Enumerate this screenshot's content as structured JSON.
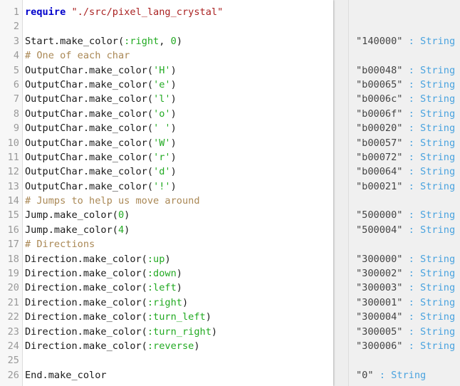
{
  "editor": {
    "lines": [
      {
        "n": "1",
        "tokens": [
          {
            "t": "kw",
            "v": "require"
          },
          {
            "t": "plain",
            "v": " "
          },
          {
            "t": "str",
            "v": "\"./src/pixel_lang_crystal\""
          }
        ]
      },
      {
        "n": "2",
        "tokens": []
      },
      {
        "n": "3",
        "tokens": [
          {
            "t": "plain",
            "v": "Start.make_color("
          },
          {
            "t": "sym",
            "v": ":right"
          },
          {
            "t": "plain",
            "v": ", "
          },
          {
            "t": "num",
            "v": "0"
          },
          {
            "t": "plain",
            "v": ")"
          }
        ]
      },
      {
        "n": "4",
        "tokens": [
          {
            "t": "cmt",
            "v": "# One of each char"
          }
        ]
      },
      {
        "n": "5",
        "tokens": [
          {
            "t": "plain",
            "v": "OutputChar.make_color("
          },
          {
            "t": "sym",
            "v": "'H'"
          },
          {
            "t": "plain",
            "v": ")"
          }
        ]
      },
      {
        "n": "6",
        "tokens": [
          {
            "t": "plain",
            "v": "OutputChar.make_color("
          },
          {
            "t": "sym",
            "v": "'e'"
          },
          {
            "t": "plain",
            "v": ")"
          }
        ]
      },
      {
        "n": "7",
        "tokens": [
          {
            "t": "plain",
            "v": "OutputChar.make_color("
          },
          {
            "t": "sym",
            "v": "'l'"
          },
          {
            "t": "plain",
            "v": ")"
          }
        ]
      },
      {
        "n": "8",
        "tokens": [
          {
            "t": "plain",
            "v": "OutputChar.make_color("
          },
          {
            "t": "sym",
            "v": "'o'"
          },
          {
            "t": "plain",
            "v": ")"
          }
        ]
      },
      {
        "n": "9",
        "tokens": [
          {
            "t": "plain",
            "v": "OutputChar.make_color("
          },
          {
            "t": "sym",
            "v": "' '"
          },
          {
            "t": "plain",
            "v": ")"
          }
        ]
      },
      {
        "n": "10",
        "tokens": [
          {
            "t": "plain",
            "v": "OutputChar.make_color("
          },
          {
            "t": "sym",
            "v": "'W'"
          },
          {
            "t": "plain",
            "v": ")"
          }
        ]
      },
      {
        "n": "11",
        "tokens": [
          {
            "t": "plain",
            "v": "OutputChar.make_color("
          },
          {
            "t": "sym",
            "v": "'r'"
          },
          {
            "t": "plain",
            "v": ")"
          }
        ]
      },
      {
        "n": "12",
        "tokens": [
          {
            "t": "plain",
            "v": "OutputChar.make_color("
          },
          {
            "t": "sym",
            "v": "'d'"
          },
          {
            "t": "plain",
            "v": ")"
          }
        ]
      },
      {
        "n": "13",
        "tokens": [
          {
            "t": "plain",
            "v": "OutputChar.make_color("
          },
          {
            "t": "sym",
            "v": "'!'"
          },
          {
            "t": "plain",
            "v": ")"
          }
        ]
      },
      {
        "n": "14",
        "tokens": [
          {
            "t": "cmt",
            "v": "# Jumps to help us move around"
          }
        ]
      },
      {
        "n": "15",
        "tokens": [
          {
            "t": "plain",
            "v": "Jump.make_color("
          },
          {
            "t": "num",
            "v": "0"
          },
          {
            "t": "plain",
            "v": ")"
          }
        ]
      },
      {
        "n": "16",
        "tokens": [
          {
            "t": "plain",
            "v": "Jump.make_color("
          },
          {
            "t": "num",
            "v": "4"
          },
          {
            "t": "plain",
            "v": ")"
          }
        ]
      },
      {
        "n": "17",
        "tokens": [
          {
            "t": "cmt",
            "v": "# Directions"
          }
        ]
      },
      {
        "n": "18",
        "tokens": [
          {
            "t": "plain",
            "v": "Direction.make_color("
          },
          {
            "t": "sym",
            "v": ":up"
          },
          {
            "t": "plain",
            "v": ")"
          }
        ]
      },
      {
        "n": "19",
        "tokens": [
          {
            "t": "plain",
            "v": "Direction.make_color("
          },
          {
            "t": "sym",
            "v": ":down"
          },
          {
            "t": "plain",
            "v": ")"
          }
        ]
      },
      {
        "n": "20",
        "tokens": [
          {
            "t": "plain",
            "v": "Direction.make_color("
          },
          {
            "t": "sym",
            "v": ":left"
          },
          {
            "t": "plain",
            "v": ")"
          }
        ]
      },
      {
        "n": "21",
        "tokens": [
          {
            "t": "plain",
            "v": "Direction.make_color("
          },
          {
            "t": "sym",
            "v": ":right"
          },
          {
            "t": "plain",
            "v": ")"
          }
        ]
      },
      {
        "n": "22",
        "tokens": [
          {
            "t": "plain",
            "v": "Direction.make_color("
          },
          {
            "t": "sym",
            "v": ":turn_left"
          },
          {
            "t": "plain",
            "v": ")"
          }
        ]
      },
      {
        "n": "23",
        "tokens": [
          {
            "t": "plain",
            "v": "Direction.make_color("
          },
          {
            "t": "sym",
            "v": ":turn_right"
          },
          {
            "t": "plain",
            "v": ")"
          }
        ]
      },
      {
        "n": "24",
        "tokens": [
          {
            "t": "plain",
            "v": "Direction.make_color("
          },
          {
            "t": "sym",
            "v": ":reverse"
          },
          {
            "t": "plain",
            "v": ")"
          }
        ]
      },
      {
        "n": "25",
        "tokens": []
      },
      {
        "n": "26",
        "tokens": [
          {
            "t": "plain",
            "v": "End.make_color"
          }
        ]
      }
    ]
  },
  "results": [
    {
      "value": "",
      "type": ""
    },
    {
      "value": "",
      "type": ""
    },
    {
      "value": "\"140000\"",
      "type": " : String"
    },
    {
      "value": "",
      "type": ""
    },
    {
      "value": "\"b00048\"",
      "type": " : String"
    },
    {
      "value": "\"b00065\"",
      "type": " : String"
    },
    {
      "value": "\"b0006c\"",
      "type": " : String"
    },
    {
      "value": "\"b0006f\"",
      "type": " : String"
    },
    {
      "value": "\"b00020\"",
      "type": " : String"
    },
    {
      "value": "\"b00057\"",
      "type": " : String"
    },
    {
      "value": "\"b00072\"",
      "type": " : String"
    },
    {
      "value": "\"b00064\"",
      "type": " : String"
    },
    {
      "value": "\"b00021\"",
      "type": " : String"
    },
    {
      "value": "",
      "type": ""
    },
    {
      "value": "\"500000\"",
      "type": " : String"
    },
    {
      "value": "\"500004\"",
      "type": " : String"
    },
    {
      "value": "",
      "type": ""
    },
    {
      "value": "\"300000\"",
      "type": " : String"
    },
    {
      "value": "\"300002\"",
      "type": " : String"
    },
    {
      "value": "\"300003\"",
      "type": " : String"
    },
    {
      "value": "\"300001\"",
      "type": " : String"
    },
    {
      "value": "\"300004\"",
      "type": " : String"
    },
    {
      "value": "\"300005\"",
      "type": " : String"
    },
    {
      "value": "\"300006\"",
      "type": " : String"
    },
    {
      "value": "",
      "type": ""
    },
    {
      "value": "\"0\"",
      "type": " : String"
    }
  ]
}
